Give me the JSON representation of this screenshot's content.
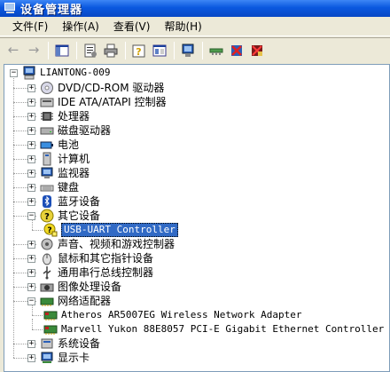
{
  "window": {
    "title": "设备管理器"
  },
  "menu": [
    {
      "label": "文件(F)"
    },
    {
      "label": "操作(A)"
    },
    {
      "label": "查看(V)"
    },
    {
      "label": "帮助(H)"
    }
  ],
  "toolbar": {
    "buttons": [
      {
        "icon": "back-arrow-icon"
      },
      {
        "icon": "forward-arrow-icon"
      },
      {
        "icon": "show-hide-console-tree-icon"
      },
      {
        "icon": "properties-icon"
      },
      {
        "icon": "print-icon"
      },
      {
        "icon": "help-icon"
      },
      {
        "icon": "console-tree-icon"
      },
      {
        "icon": "scan-hardware-icon"
      },
      {
        "icon": "update-driver-icon"
      },
      {
        "icon": "disable-device-icon"
      },
      {
        "icon": "uninstall-device-icon"
      }
    ]
  },
  "tree": {
    "root": {
      "label": "LIANTONG-009",
      "expander": "−"
    },
    "items": [
      {
        "label": "DVD/CD-ROM 驱动器",
        "icon": "dvd-drive-icon",
        "expander": "+"
      },
      {
        "label": "IDE ATA/ATAPI 控制器",
        "icon": "ide-controller-icon",
        "expander": "+"
      },
      {
        "label": "处理器",
        "icon": "processor-icon",
        "expander": "+"
      },
      {
        "label": "磁盘驱动器",
        "icon": "disk-drive-icon",
        "expander": "+"
      },
      {
        "label": "电池",
        "icon": "battery-icon",
        "expander": "+"
      },
      {
        "label": "计算机",
        "icon": "computer-icon",
        "expander": "+"
      },
      {
        "label": "监视器",
        "icon": "monitor-icon",
        "expander": "+"
      },
      {
        "label": "键盘",
        "icon": "keyboard-icon",
        "expander": "+"
      },
      {
        "label": "蓝牙设备",
        "icon": "bluetooth-icon",
        "expander": "+"
      },
      {
        "label": "其它设备",
        "icon": "unknown-device-icon",
        "expander": "−"
      },
      {
        "label": "USB-UART Controller",
        "icon": "warning-device-icon",
        "child": true,
        "selected": true
      },
      {
        "label": "声音、视频和游戏控制器",
        "icon": "sound-icon",
        "expander": "+"
      },
      {
        "label": "鼠标和其它指针设备",
        "icon": "mouse-icon",
        "expander": "+"
      },
      {
        "label": "通用串行总线控制器",
        "icon": "usb-icon",
        "expander": "+"
      },
      {
        "label": "图像处理设备",
        "icon": "imaging-icon",
        "expander": "+"
      },
      {
        "label": "网络适配器",
        "icon": "network-adapter-icon",
        "expander": "−"
      },
      {
        "label": "Atheros AR5007EG Wireless Network Adapter",
        "icon": "network-card-icon",
        "child": true
      },
      {
        "label": "Marvell Yukon 88E8057 PCI-E Gigabit Ethernet Controller",
        "icon": "network-card-icon",
        "child": true
      },
      {
        "label": "系统设备",
        "icon": "system-device-icon",
        "expander": "+"
      },
      {
        "label": "显示卡",
        "icon": "display-adapter-icon",
        "expander": "+"
      }
    ]
  }
}
